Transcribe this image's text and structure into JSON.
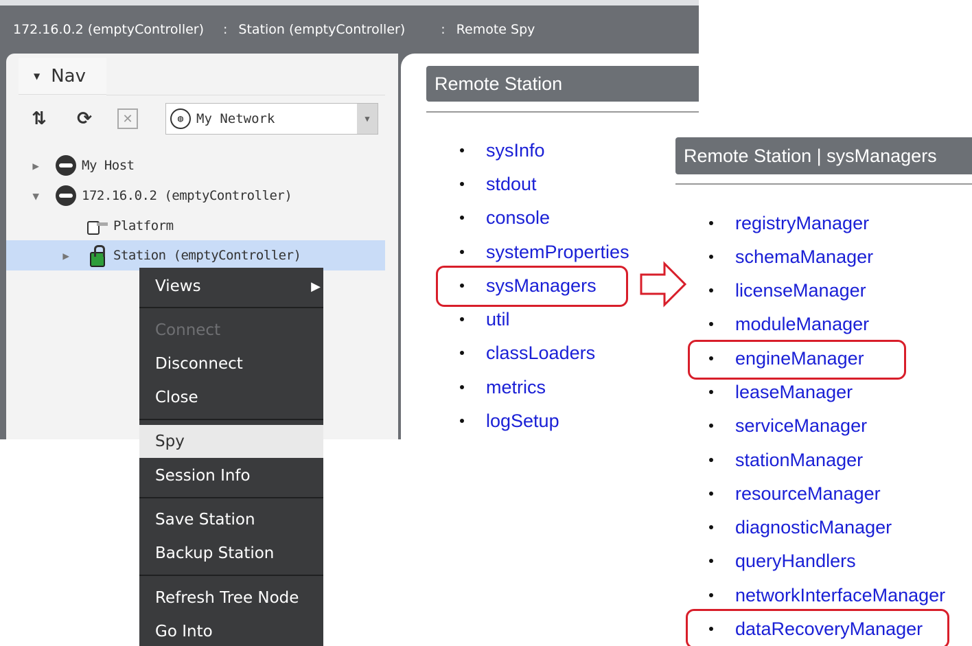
{
  "breadcrumb": {
    "items": [
      "172.16.0.2 (emptyController)",
      "Station (emptyController)",
      "Remote Spy"
    ],
    "separator": ":"
  },
  "nav": {
    "tab_label": "Nav",
    "network_select": "My Network",
    "tree": [
      {
        "label": "My Host"
      },
      {
        "label": "172.16.0.2 (emptyController)"
      },
      {
        "label": "Platform"
      },
      {
        "label": "Station (emptyController)"
      }
    ]
  },
  "context_menu": {
    "items": [
      "Views",
      "Connect",
      "Disconnect",
      "Close",
      "Spy",
      "Session Info",
      "Save Station",
      "Backup Station",
      "Refresh Tree Node",
      "Go Into"
    ]
  },
  "remote_station": {
    "title": "Remote Station",
    "links": [
      "sysInfo",
      "stdout",
      "console",
      "systemProperties",
      "sysManagers",
      "util",
      "classLoaders",
      "metrics",
      "logSetup"
    ]
  },
  "sys_managers": {
    "title": "Remote Station | sysManagers",
    "links": [
      "registryManager",
      "schemaManager",
      "licenseManager",
      "moduleManager",
      "engineManager",
      "leaseManager",
      "serviceManager",
      "stationManager",
      "resourceManager",
      "diagnosticManager",
      "queryHandlers",
      "networkInterfaceManager",
      "dataRecoveryManager"
    ]
  },
  "colors": {
    "highlight": "#d81e2a",
    "link": "#1a20d6",
    "header_bg": "#6c7075"
  }
}
